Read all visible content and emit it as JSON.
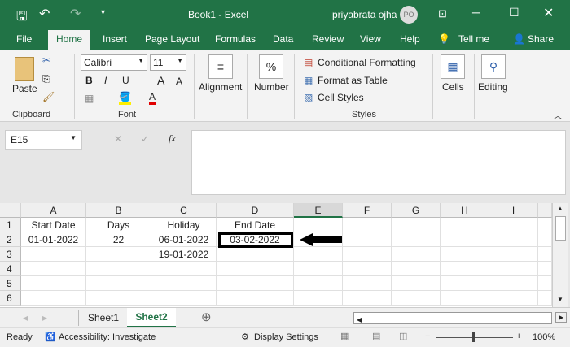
{
  "titlebar": {
    "title": "Book1  -  Excel",
    "user": "priyabrata ojha",
    "avatar": "PO"
  },
  "tabs": [
    "File",
    "Home",
    "Insert",
    "Page Layout",
    "Formulas",
    "Data",
    "Review",
    "View",
    "Help",
    "Tell me",
    "Share"
  ],
  "ribbon": {
    "clipboard": {
      "paste": "Paste",
      "label": "Clipboard"
    },
    "font": {
      "name": "Calibri",
      "size": "11",
      "bold": "B",
      "italic": "I",
      "underline": "U",
      "grow": "A",
      "shrink": "A",
      "color": "A",
      "label": "Font"
    },
    "alignment": "Alignment",
    "number": "Number",
    "number_icon": "%",
    "styles": {
      "conditional": "Conditional Formatting",
      "table": "Format as Table",
      "cell": "Cell Styles",
      "label": "Styles"
    },
    "cells": "Cells",
    "editing": "Editing"
  },
  "formula_bar": {
    "name_box": "E15",
    "fx": "fx",
    "value": ""
  },
  "grid": {
    "columns": [
      "A",
      "B",
      "C",
      "D",
      "E",
      "F",
      "G",
      "H",
      "I"
    ],
    "rows": [
      "1",
      "2",
      "3",
      "4",
      "5",
      "6"
    ],
    "cells": {
      "A1": "Start Date",
      "B1": "Days",
      "C1": "Holiday",
      "D1": "End Date",
      "A2": "01-01-2022",
      "B2": "22",
      "C2": "06-01-2022",
      "D2": "03-02-2022",
      "C3": "19-01-2022"
    }
  },
  "sheets": [
    "Sheet1",
    "Sheet2"
  ],
  "status": {
    "ready": "Ready",
    "accessibility": "Accessibility: Investigate",
    "display": "Display Settings",
    "zoom": "100%"
  },
  "colors": {
    "brand": "#217346"
  }
}
